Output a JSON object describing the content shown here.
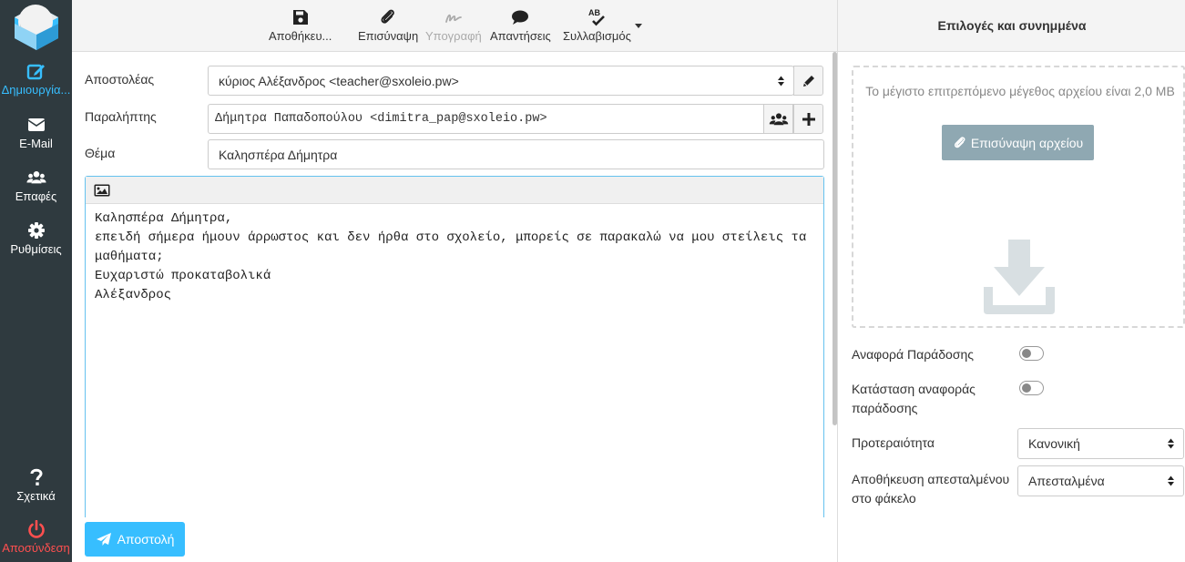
{
  "nav": {
    "items": [
      {
        "label": "Δημιουργία...",
        "icon": "compose-icon"
      },
      {
        "label": "E-Mail",
        "icon": "envelope-icon"
      },
      {
        "label": "Επαφές",
        "icon": "contacts-icon"
      },
      {
        "label": "Ρυθμίσεις",
        "icon": "gear-icon"
      },
      {
        "label": "Σχετικά",
        "icon": "question-icon"
      },
      {
        "label": "Αποσύνδεση",
        "icon": "power-icon"
      }
    ]
  },
  "toolbar": {
    "save_label": "Αποθήκευ...",
    "attach_label": "Επισύναψη",
    "signature_label": "Υπογραφή",
    "responses_label": "Απαντήσεις",
    "spell_label": "Συλλαβισμός"
  },
  "compose": {
    "from_label": "Αποστολέας",
    "from_value": "κύριος Αλέξανδρος <teacher@sxoleio.pw>",
    "to_label": "Παραλήπτης",
    "to_value": "Δήμητρα Παπαδοπούλου <dimitra_pap@sxoleio.pw>",
    "subject_label": "Θέμα",
    "subject_value": "Καλησπέρα Δήμητρα",
    "body": "Καλησπέρα Δήμητρα,\nεπειδή σήμερα ήμουν άρρωστος και δεν ήρθα στο σχολείο, μπορείς σε παρακαλώ να μου στείλεις τα μαθήματα;\nΕυχαριστώ προκαταβολικά\nΑλέξανδρος",
    "send_label": "Αποστολή"
  },
  "options": {
    "title": "Επιλογές και συνημμένα",
    "max_size_text": "Το μέγιστο επιτρεπόμενο μέγεθος αρχείου είναι 2,0 MB",
    "attach_file_label": "Επισύναψη αρχείου",
    "delivery_receipt_label": "Αναφορά Παράδοσης",
    "delivery_status_label": "Κατάσταση αναφοράς παράδοσης",
    "priority_label": "Προτεραιότητα",
    "priority_value": "Κανονική",
    "save_sent_label": "Αποθήκευση απεσταλμένου στο φάκελο",
    "save_sent_value": "Απεσταλμένα"
  },
  "colors": {
    "accent": "#37beff",
    "nav_bg": "#2f3a3f",
    "logout": "#ff4f4f",
    "attach_button": "#8fa8b2"
  }
}
